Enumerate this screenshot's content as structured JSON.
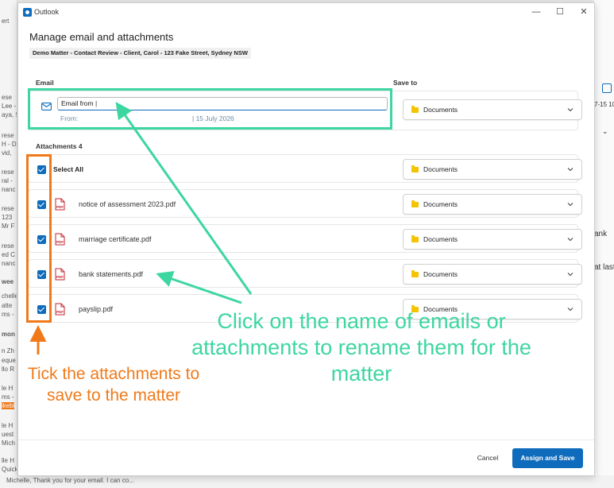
{
  "background": {
    "left_fragments": [
      "ert",
      "ese",
      "Lee -",
      "aya, S",
      "rese",
      "H - D",
      "vid,",
      "rese",
      "ral -",
      "nanc",
      "rese",
      "123",
      "Mr F",
      "rese",
      "ed C",
      "nanc",
      "wee",
      "chelle",
      "atte",
      "ms -",
      "mon",
      "n Zh",
      "eque",
      "llo R",
      "le H",
      "ms -",
      "ikebi",
      "le H",
      "uest",
      "Mich",
      "lle H",
      "Quick",
      "Mich"
    ],
    "right_fragments": [
      "7-15 10",
      "ank",
      "at last"
    ],
    "bottom_preview": "Michelle, Thank you for your email. I can co..."
  },
  "window": {
    "app_name": "Outlook",
    "controls": {
      "minimize": "—",
      "maximize": "☐",
      "close": "✕"
    }
  },
  "dialog": {
    "title": "Manage email and attachments",
    "matter": "Demo Matter - Contact Review - Client, Carol - 123 Fake Street, Sydney NSW",
    "email_section_label": "Email",
    "save_to_label": "Save to",
    "email": {
      "name_value": "Email from",
      "from_label": "From:",
      "date_text": "| 15 July 2026",
      "save_to": "Documents"
    },
    "attachments_label": "Attachments 4",
    "select_all": {
      "label": "Select All",
      "checked": true,
      "save_to": "Documents"
    },
    "attachments": [
      {
        "name": "notice of assessment 2023.pdf",
        "checked": true,
        "save_to": "Documents"
      },
      {
        "name": "marriage certificate.pdf",
        "checked": true,
        "save_to": "Documents"
      },
      {
        "name": "bank statements.pdf",
        "checked": true,
        "save_to": "Documents"
      },
      {
        "name": "payslip.pdf",
        "checked": true,
        "save_to": "Documents"
      }
    ],
    "file_badge": "PDF",
    "cancel_label": "Cancel",
    "assign_label": "Assign and Save"
  },
  "annotations": {
    "rename_hint": "Click on the name of emails or attachments to rename them for the matter",
    "tick_hint": "Tick the attachments to save to the matter",
    "colors": {
      "green": "#3dd6a0",
      "orange": "#f07a1a",
      "accent": "#0f6cbd",
      "folder": "#f5c400"
    }
  }
}
